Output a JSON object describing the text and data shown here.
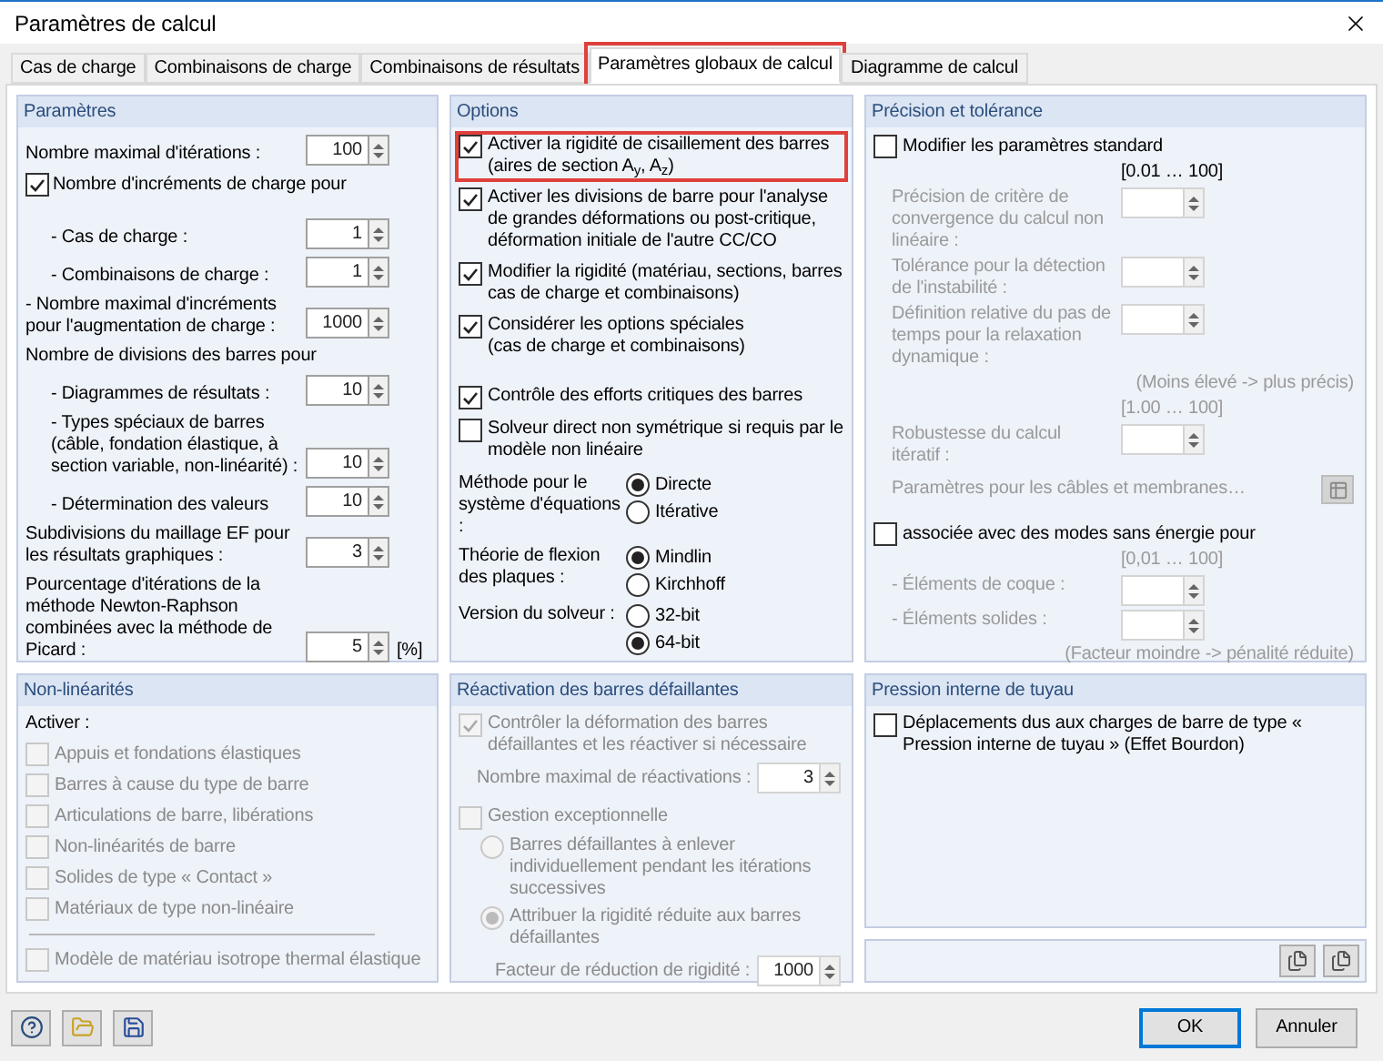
{
  "window": {
    "title": "Paramètres de calcul"
  },
  "tabs": [
    {
      "label": "Cas de charge",
      "selected": false,
      "highlighted": false
    },
    {
      "label": "Combinaisons de charge",
      "selected": false,
      "highlighted": false
    },
    {
      "label": "Combinaisons de résultats",
      "selected": false,
      "highlighted": false
    },
    {
      "label": "Paramètres globaux de calcul",
      "selected": true,
      "highlighted": true
    },
    {
      "label": "Diagramme de calcul",
      "selected": false,
      "highlighted": false
    }
  ],
  "parameters": {
    "title": "Paramètres",
    "rows": [
      {
        "kind": "field",
        "label": "Nombre maximal d'itérations :",
        "value": "100"
      },
      {
        "kind": "checkbox",
        "label": "Nombre d'incréments de charge pour",
        "checked": true
      },
      {
        "kind": "subfield",
        "label": "- Cas de charge :",
        "value": "1"
      },
      {
        "kind": "subfield",
        "label": "- Combinaisons de charge :",
        "value": "1"
      },
      {
        "kind": "field",
        "label": "- Nombre maximal d'incréments pour l'augmentation de charge :",
        "value": "1000"
      },
      {
        "kind": "text",
        "label": "Nombre de divisions des barres pour"
      },
      {
        "kind": "subfield",
        "label": "- Diagrammes de résultats :",
        "value": "10"
      },
      {
        "kind": "subfield",
        "label": "- Types spéciaux de barres\n(câble, fondation élastique, à section variable, non-linéarité) :",
        "value": "10"
      },
      {
        "kind": "subfield",
        "label": "- Détermination des valeurs",
        "value": "10"
      },
      {
        "kind": "field",
        "label": "Subdivisions du maillage EF pour les résultats graphiques :",
        "value": "3"
      },
      {
        "kind": "field",
        "label": "Pourcentage d'itérations de la méthode Newton-Raphson combinées avec la méthode de Picard :",
        "value": "5",
        "unit": "[%]"
      }
    ]
  },
  "options": {
    "title": "Options",
    "checks": [
      {
        "label": "Activer la rigidité de cisaillement des barres\n(aires de section A$_{y}$, A$_{z}$)",
        "checked": true,
        "highlighted": true
      },
      {
        "label": "Activer les divisions de barre pour l'analyse de grandes déformations ou post-critique, déformation initiale de l'autre CC/CO",
        "checked": true,
        "highlighted": false
      },
      {
        "label": "Modifier la rigidité (matériau, sections, barres\ncas de charge et combinaisons)",
        "checked": true,
        "highlighted": false
      },
      {
        "label": "Considérer les options spéciales\n(cas de charge et combinaisons)",
        "checked": true,
        "highlighted": false
      },
      {
        "label": "Contrôle des efforts critiques des barres",
        "checked": true,
        "highlighted": false
      }
    ],
    "solver_check": {
      "label": "Solveur direct non symétrique si requis par le modèle non linéaire",
      "checked": false
    },
    "radio_groups": [
      {
        "label": "Méthode pour le système d'équations :",
        "options": [
          {
            "label": "Directe",
            "selected": true
          },
          {
            "label": "Itérative",
            "selected": false
          }
        ]
      },
      {
        "label": "Théorie de flexion des plaques :",
        "options": [
          {
            "label": "Mindlin",
            "selected": true
          },
          {
            "label": "Kirchhoff",
            "selected": false
          }
        ]
      },
      {
        "label": "Version du solveur :",
        "options": [
          {
            "label": "32-bit",
            "selected": false
          },
          {
            "label": "64-bit",
            "selected": true
          }
        ]
      }
    ]
  },
  "precision": {
    "title": "Précision et tolérance",
    "items": [
      {
        "kind": "checkbox",
        "label": "Modifier les paramètres standard",
        "checked": false,
        "disabled": false
      },
      {
        "kind": "range",
        "label": "[0.01 … 100]",
        "disabled": false
      },
      {
        "kind": "field",
        "label": "Précision de critère de convergence du calcul non linéaire :",
        "disabled": true
      },
      {
        "kind": "field",
        "label": "Tolérance pour la détection de l'instabilité :",
        "disabled": true
      },
      {
        "kind": "field",
        "label": "Définition relative du pas de temps pour la relaxation dynamique :",
        "disabled": true
      },
      {
        "kind": "note",
        "label": "(Moins élevé -> plus précis)",
        "disabled": true
      },
      {
        "kind": "range",
        "label": "[1.00 … 100]",
        "disabled": true
      },
      {
        "kind": "field",
        "label": "Robustesse du calcul itératif :",
        "disabled": true
      },
      {
        "kind": "button",
        "label": "Paramètres pour les câbles et membranes…",
        "disabled": true
      },
      {
        "kind": "checkbox",
        "label": "associée avec des modes sans énergie pour",
        "checked": false,
        "disabled": false
      },
      {
        "kind": "range",
        "label": "[0,01 … 100]",
        "disabled": true
      },
      {
        "kind": "field",
        "label": "- Éléments de coque :",
        "disabled": true
      },
      {
        "kind": "field",
        "label": "- Éléments solides :",
        "disabled": true
      },
      {
        "kind": "note",
        "label": "(Facteur moindre -> pénalité réduite)",
        "disabled": true
      }
    ]
  },
  "nonlinear": {
    "title": "Non-linéarités",
    "heading": "Activer :",
    "checks": [
      {
        "label": "Appuis et fondations élastiques",
        "checked": false,
        "disabled": true
      },
      {
        "label": "Barres à cause du type de barre",
        "checked": false,
        "disabled": true
      },
      {
        "label": "Articulations de barre, libérations",
        "checked": false,
        "disabled": true
      },
      {
        "label": "Non-linéarités de barre",
        "checked": false,
        "disabled": true
      },
      {
        "label": "Solides de type « Contact »",
        "checked": false,
        "disabled": true
      },
      {
        "label": "Matériaux de type non-linéaire",
        "checked": false,
        "disabled": true
      }
    ],
    "extra": {
      "label": "Modèle de matériau isotrope thermal élastique",
      "checked": false,
      "disabled": true
    }
  },
  "reactivation": {
    "title": "Réactivation des barres défaillantes",
    "items": [
      {
        "kind": "checkbox",
        "label": "Contrôler la déformation des barres défaillantes et les réactiver si nécessaire",
        "checked": true,
        "disabled": true
      },
      {
        "kind": "field",
        "label": "Nombre maximal de réactivations :",
        "value": "3",
        "disabled": true
      },
      {
        "kind": "checkbox",
        "label": "Gestion exceptionnelle",
        "checked": false,
        "disabled": true
      },
      {
        "kind": "radio",
        "label": "Barres défaillantes à enlever individuellement pendant les itérations successives",
        "selected": false,
        "disabled": true
      },
      {
        "kind": "radio",
        "label": "Attribuer la rigidité réduite aux barres défaillantes",
        "selected": true,
        "disabled": true
      },
      {
        "kind": "field",
        "label": "Facteur de réduction de rigidité :",
        "value": "1000",
        "disabled": true,
        "indent": true
      }
    ]
  },
  "pipe": {
    "title": "Pression interne de tuyau",
    "check": {
      "label": "Déplacements dus aux charges de barre de type « Pression interne de tuyau » (Effet Bourdon)",
      "checked": false
    }
  },
  "buttons": [
    {
      "label": "OK",
      "default": true
    },
    {
      "label": "Annuler",
      "default": false
    }
  ]
}
